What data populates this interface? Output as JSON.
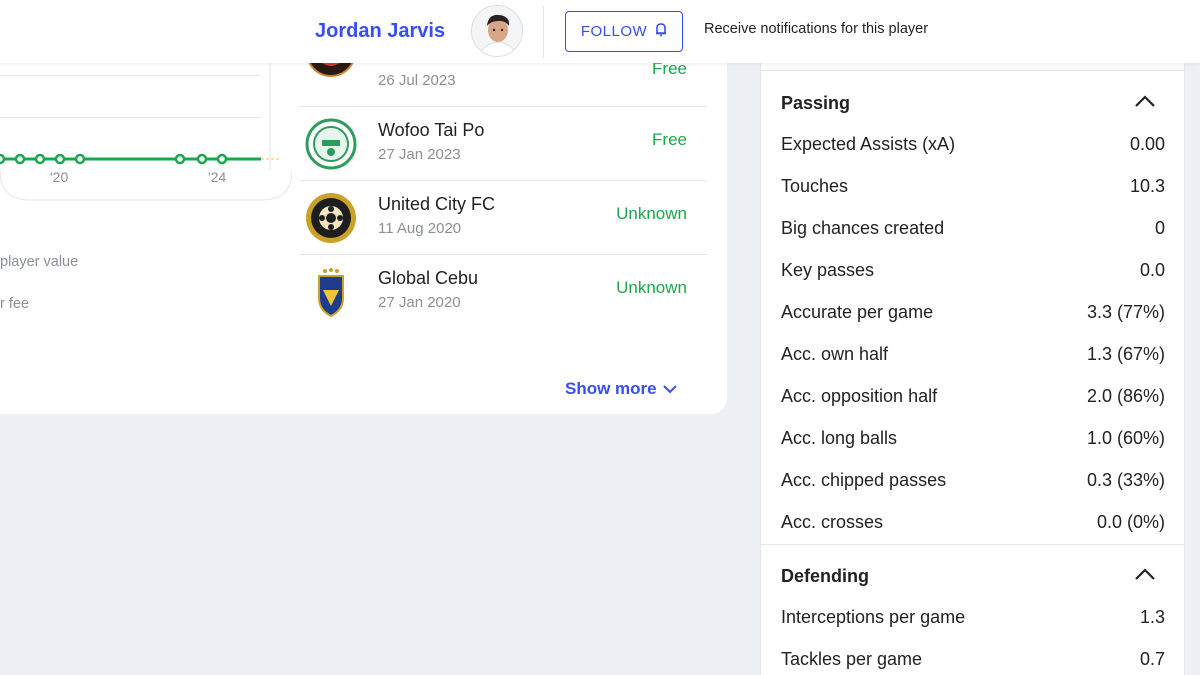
{
  "header": {
    "player_name": "Jordan Jarvis",
    "follow_label": "FOLLOW",
    "notify_text": "Receive notifications for this player"
  },
  "chart": {
    "x_ticks": [
      "'20",
      "'24"
    ],
    "legend": [
      "player value",
      "r fee"
    ],
    "line_color": "#1aa74d"
  },
  "transfers": {
    "rows": [
      {
        "club": "",
        "date": "26 Jul 2023",
        "fee": "Free"
      },
      {
        "club": "Wofoo Tai Po",
        "date": "27 Jan 2023",
        "fee": "Free"
      },
      {
        "club": "United City FC",
        "date": "11 Aug 2020",
        "fee": "Unknown"
      },
      {
        "club": "Global Cebu",
        "date": "27 Jan 2020",
        "fee": "Unknown"
      }
    ],
    "show_more": "Show more"
  },
  "stats": {
    "passing": {
      "title": "Passing",
      "rows": [
        {
          "label": "Expected Assists (xA)",
          "value": "0.00"
        },
        {
          "label": "Touches",
          "value": "10.3"
        },
        {
          "label": "Big chances created",
          "value": "0"
        },
        {
          "label": "Key passes",
          "value": "0.0"
        },
        {
          "label": "Accurate per game",
          "value": "3.3 (77%)"
        },
        {
          "label": "Acc. own half",
          "value": "1.3 (67%)"
        },
        {
          "label": "Acc. opposition half",
          "value": "2.0 (86%)"
        },
        {
          "label": "Acc. long balls",
          "value": "1.0 (60%)"
        },
        {
          "label": "Acc. chipped passes",
          "value": "0.3 (33%)"
        },
        {
          "label": "Acc. crosses",
          "value": "0.0 (0%)"
        }
      ]
    },
    "defending": {
      "title": "Defending",
      "rows": [
        {
          "label": "Interceptions per game",
          "value": "1.3"
        },
        {
          "label": "Tackles per game",
          "value": "0.7"
        }
      ]
    }
  },
  "colors": {
    "accent": "#374df5",
    "positive": "#1aa74d",
    "muted": "#8a8f96"
  }
}
